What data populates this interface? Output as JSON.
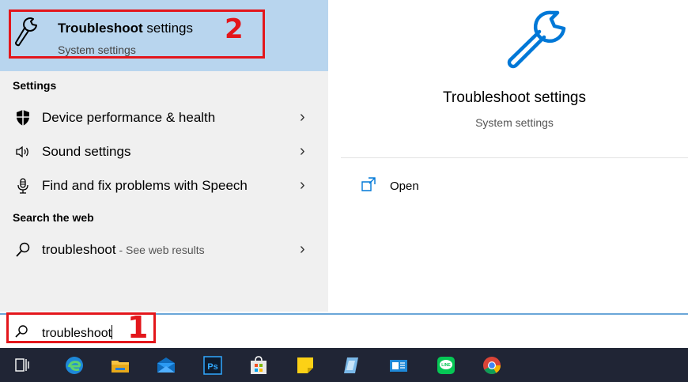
{
  "best_match": {
    "title_bold": "Troubleshoot",
    "title_rest": " settings",
    "subtitle": "System settings",
    "icon": "wrench-icon"
  },
  "sections": {
    "settings": "Settings",
    "web": "Search the web"
  },
  "settings_items": [
    {
      "label": "Device performance & health",
      "icon": "shield-icon"
    },
    {
      "label": "Sound settings",
      "icon": "speaker-icon"
    },
    {
      "label": "Find and fix problems with Speech",
      "icon": "microphone-icon"
    }
  ],
  "web_item": {
    "query": "troubleshoot",
    "suffix": " - See web results",
    "icon": "search-icon"
  },
  "preview": {
    "title": "Troubleshoot settings",
    "subtitle": "System settings",
    "open_label": "Open"
  },
  "search": {
    "value": "troubleshoot"
  },
  "annotations": {
    "marker_1": "1",
    "marker_2": "2",
    "color": "#e3161b"
  },
  "taskbar": [
    "task-view-icon",
    "edge-icon",
    "file-explorer-icon",
    "mail-icon",
    "photoshop-icon",
    "store-icon",
    "sticky-notes-icon",
    "app-icon",
    "news-icon",
    "line-icon",
    "chrome-icon"
  ],
  "colors": {
    "accent": "#0078d7",
    "highlight": "#b8d5ee",
    "taskbar": "#202535"
  }
}
